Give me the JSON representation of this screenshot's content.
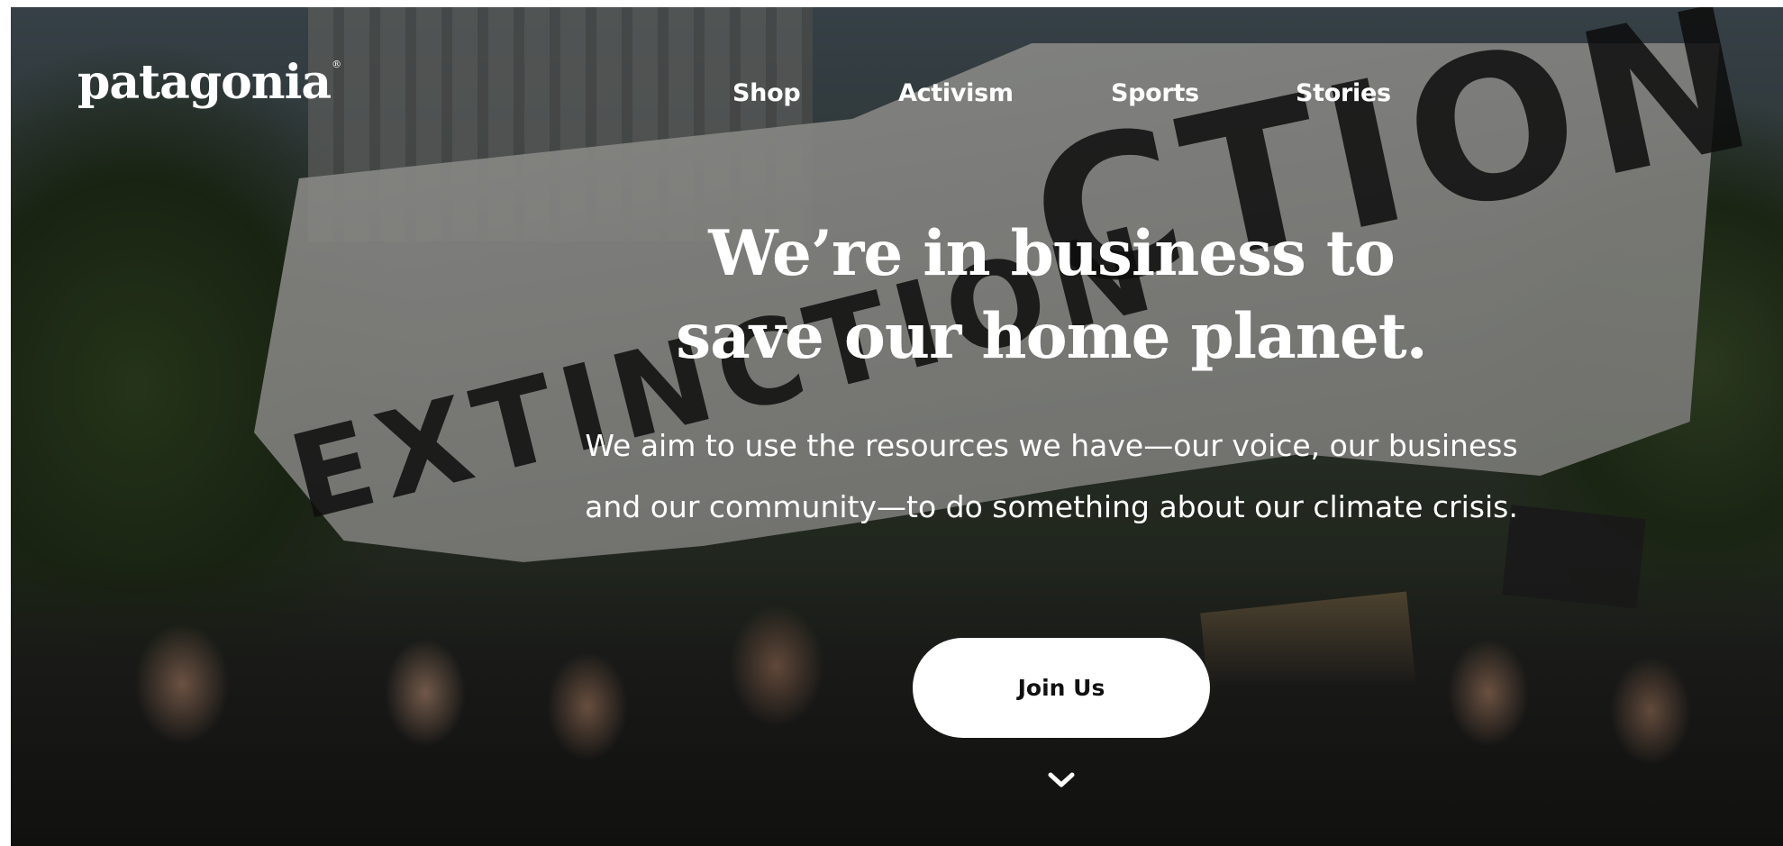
{
  "brand": {
    "logo_text": "patagonia",
    "logo_mark": "®"
  },
  "nav": {
    "items": [
      {
        "label": "Shop"
      },
      {
        "label": "Activism"
      },
      {
        "label": "Sports"
      },
      {
        "label": "Stories"
      }
    ]
  },
  "hero": {
    "headline_line1": "We’re in business to",
    "headline_line2": "save our home planet.",
    "subtext": "We aim to use the resources we have—our voice, our business and our community—to do something about our climate crisis.",
    "cta_label": "Join Us",
    "scroll_icon": "chevron-down-icon",
    "banner_text": [
      "EXTINCTION",
      "CTION"
    ]
  },
  "colors": {
    "text": "#ffffff",
    "button_bg": "#ffffff",
    "button_text": "#111111",
    "overlay": "rgba(0,0,0,0.42)"
  }
}
